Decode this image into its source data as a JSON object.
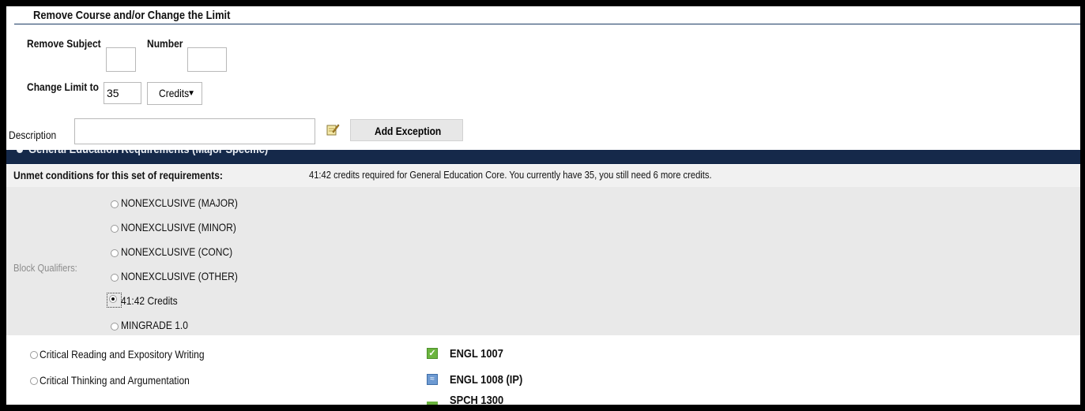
{
  "form": {
    "title": "Remove Course and/or Change the Limit",
    "remove_subject_label": "Remove Subject",
    "remove_subject_value": "",
    "number_label": "Number",
    "number_value": "",
    "change_limit_label": "Change Limit to",
    "change_limit_value": "35",
    "limit_unit_selected": "Credits",
    "description_label": "Description",
    "description_value": "",
    "add_exception_label": "Add Exception"
  },
  "block": {
    "header_title": "General Education Requirements (Major Specific)",
    "unmet_label": "Unmet conditions for this set of requirements:",
    "unmet_message": "41:42 credits required for General Education Core. You currently have 35, you still need 6 more credits.",
    "qualifiers_label": "Block Qualifiers:",
    "qualifiers": [
      {
        "label": "NONEXCLUSIVE (MAJOR)",
        "selected": false
      },
      {
        "label": "NONEXCLUSIVE (MINOR)",
        "selected": false
      },
      {
        "label": "NONEXCLUSIVE (CONC)",
        "selected": false
      },
      {
        "label": "NONEXCLUSIVE (OTHER)",
        "selected": false
      },
      {
        "label": "41:42 Credits",
        "selected": true
      },
      {
        "label": "MINGRADE 1.0",
        "selected": false
      }
    ]
  },
  "requirements": [
    {
      "label": "Critical Reading and Expository Writing",
      "status_icon": "complete-check-icon",
      "course": "ENGL 1007"
    },
    {
      "label": "Critical Thinking and Argumentation",
      "status_icon": "in-progress-icon",
      "course": "ENGL 1008 (IP)"
    },
    {
      "label": "",
      "status_icon": "complete-check-icon",
      "course": "SPCH 1300"
    }
  ],
  "colors": {
    "band": "#15294a",
    "complete": "#6bb43e",
    "in_progress": "#6d9ad2"
  }
}
